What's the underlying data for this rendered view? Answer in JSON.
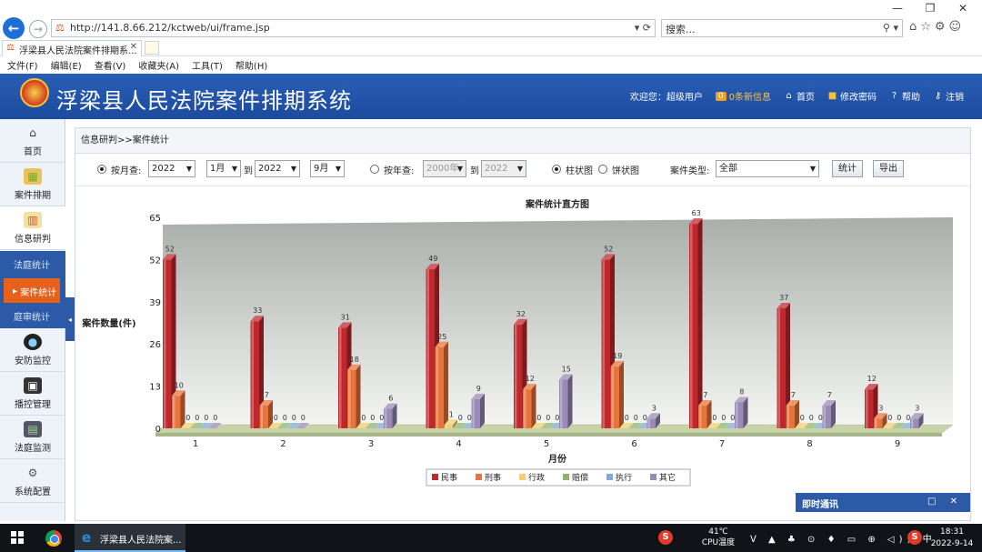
{
  "browser": {
    "url": "http://141.8.66.212/kctweb/ui/frame.jsp",
    "url_tools": "▾ ⟳",
    "search_placeholder": "搜索...",
    "tab_title": "浮梁县人民法院案件排期系...",
    "menu": [
      "文件(F)",
      "编辑(E)",
      "查看(V)",
      "收藏夹(A)",
      "工具(T)",
      "帮助(H)"
    ]
  },
  "header": {
    "title": "浮梁县人民法院案件排期系统",
    "welcome": "欢迎您：超级用户",
    "messages": "0条新信息",
    "msg_count": "0",
    "home": "首页",
    "change_password": "修改密码",
    "help": "帮助",
    "logout": "注销"
  },
  "sidebar": {
    "items": [
      {
        "label": "首页",
        "icon": "home-icon"
      },
      {
        "label": "案件排期",
        "icon": "calendar-icon"
      },
      {
        "label": "信息研判",
        "icon": "chart-icon"
      },
      {
        "label": "安防监控",
        "icon": "camera-icon"
      },
      {
        "label": "播控管理",
        "icon": "monitor-icon"
      },
      {
        "label": "法庭监测",
        "icon": "screen-icon"
      },
      {
        "label": "系统配置",
        "icon": "gear-icon"
      }
    ],
    "sub_items": [
      "法庭统计",
      "案件统计",
      "庭审统计"
    ],
    "active_sub": "案件统计"
  },
  "breadcrumb": "信息研判>>案件统计",
  "filters": {
    "by_month_label": "按月查:",
    "year_from": "2022",
    "month_from": "1月",
    "to_label": "到",
    "year_to": "2022",
    "month_to": "9月",
    "by_year_label": "按年查:",
    "year_range_from": "2000年",
    "year_range_to": "2022",
    "bar_chart_label": "柱状图",
    "pie_chart_label": "饼状图",
    "case_type_label": "案件类型:",
    "case_type_value": "全部",
    "stat_button": "统计",
    "export_button": "导出"
  },
  "chart_data": {
    "type": "bar",
    "title": "案件统计直方图",
    "xlabel": "月份",
    "ylabel": "案件数量(件)",
    "ylim": [
      0,
      65
    ],
    "yticks": [
      0,
      13,
      26,
      39,
      52,
      65
    ],
    "categories": [
      "1",
      "2",
      "3",
      "4",
      "5",
      "6",
      "7",
      "8",
      "9"
    ],
    "series": [
      {
        "name": "民事",
        "color": "#c0282e",
        "values": [
          52,
          33,
          31,
          49,
          32,
          52,
          63,
          37,
          12
        ]
      },
      {
        "name": "刑事",
        "color": "#e8743b",
        "values": [
          10,
          7,
          18,
          25,
          12,
          19,
          7,
          7,
          3
        ]
      },
      {
        "name": "行政",
        "color": "#f2cf6b",
        "values": [
          0,
          0,
          0,
          1,
          0,
          0,
          0,
          0,
          0
        ]
      },
      {
        "name": "赔偿",
        "color": "#8cb46a",
        "values": [
          0,
          0,
          0,
          0,
          0,
          0,
          0,
          0,
          0
        ]
      },
      {
        "name": "执行",
        "color": "#7fa9d8",
        "values": [
          0,
          0,
          0,
          0,
          0,
          0,
          0,
          0,
          0
        ]
      },
      {
        "name": "其它",
        "color": "#9b8ab5",
        "values": [
          0,
          0,
          6,
          9,
          15,
          3,
          8,
          7,
          3
        ]
      }
    ],
    "legend_position": "bottom"
  },
  "im_panel": {
    "title": "即时通讯",
    "controls": "□ ✕"
  },
  "taskbar": {
    "window_label": "浮梁县人民法院案...",
    "temperature": "41℃",
    "temperature_label": "CPU温度",
    "tray": "ᐯ ▲ ♣ ⊙ ♦ ▭ ⊕ ◁)) 中",
    "time": "18:31",
    "date": "2022-9-14"
  }
}
